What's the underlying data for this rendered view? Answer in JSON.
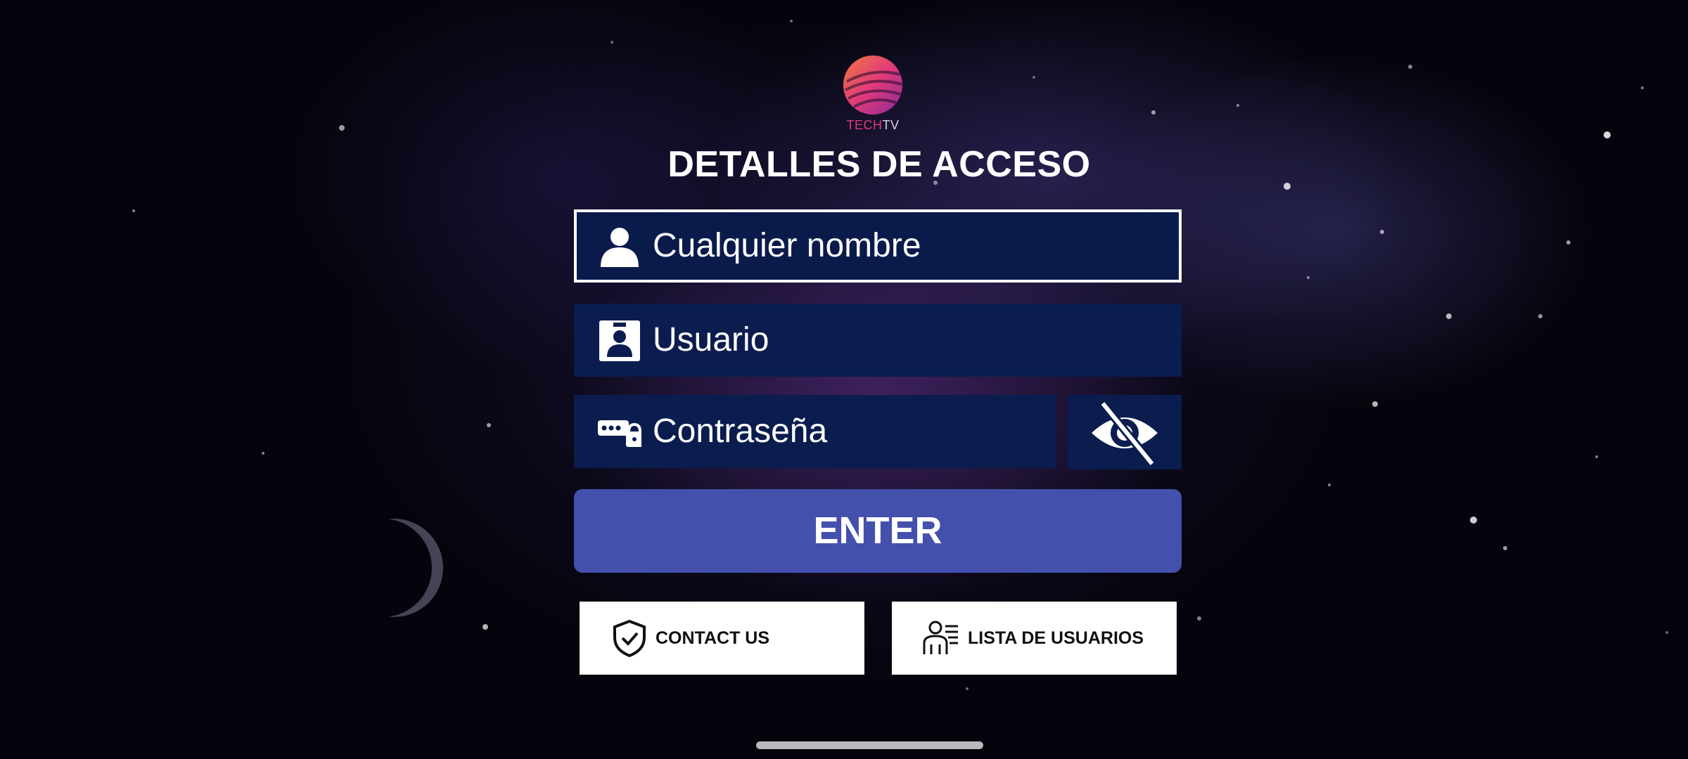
{
  "logo": {
    "text_a": "TECH",
    "text_b": "TV"
  },
  "title": "DETALLES DE ACCESO",
  "form": {
    "name_field": {
      "placeholder": "Cualquier nombre",
      "icon": "person-icon"
    },
    "user_field": {
      "placeholder": "Usuario",
      "icon": "id-badge-icon"
    },
    "password_field": {
      "placeholder": "Contraseña",
      "icon": "password-lock-icon"
    },
    "toggle_visibility_icon": "eye-off-icon",
    "enter_label": "ENTER"
  },
  "buttons": {
    "contact_label": "CONTACT US",
    "users_label": "LISTA DE USUARIOS"
  },
  "colors": {
    "field_bg": "#0b1d4f",
    "enter_bg": "#4350ac",
    "logo_pink": "#e23a7a",
    "logo_orange": "#f07a3a"
  }
}
